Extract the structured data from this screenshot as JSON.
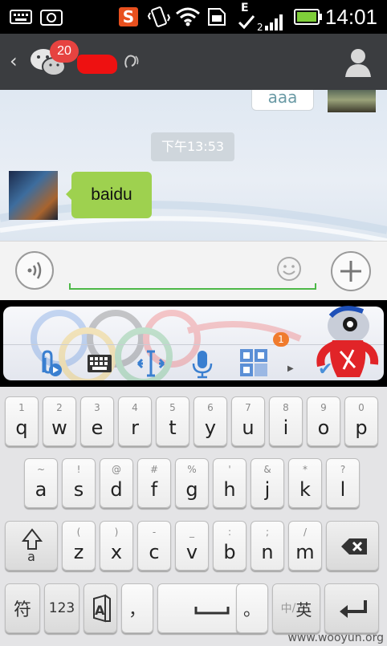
{
  "status_bar": {
    "time": "14:01",
    "icons": [
      "keyboard-icon",
      "screenshot-icon",
      "sogou-s-icon",
      "vibrate-icon",
      "wifi-icon",
      "sim-icon",
      "edge-signal-icon",
      "battery-icon"
    ],
    "sogou_letter": "S",
    "edge_letter": "E"
  },
  "header": {
    "unread_badge": "20",
    "back_glyph": "‹"
  },
  "chat": {
    "sent_message_partial": "aaa",
    "timestamp": "下午13:53",
    "received_message": "baidu"
  },
  "ime_toolbar": {
    "notification_count": "1",
    "tools": [
      "attachment-icon",
      "keyboard-switch-icon",
      "cursor-move-icon",
      "microphone-icon",
      "grid-apps-icon"
    ]
  },
  "keyboard": {
    "row1": [
      {
        "alt": "1",
        "key": "q"
      },
      {
        "alt": "2",
        "key": "w"
      },
      {
        "alt": "3",
        "key": "e"
      },
      {
        "alt": "4",
        "key": "r"
      },
      {
        "alt": "5",
        "key": "t"
      },
      {
        "alt": "6",
        "key": "y"
      },
      {
        "alt": "7",
        "key": "u"
      },
      {
        "alt": "8",
        "key": "i"
      },
      {
        "alt": "9",
        "key": "o"
      },
      {
        "alt": "0",
        "key": "p"
      }
    ],
    "row2": [
      {
        "alt": "~",
        "key": "a"
      },
      {
        "alt": "!",
        "key": "s"
      },
      {
        "alt": "@",
        "key": "d"
      },
      {
        "alt": "#",
        "key": "f"
      },
      {
        "alt": "%",
        "key": "g"
      },
      {
        "alt": "'",
        "key": "h"
      },
      {
        "alt": "&",
        "key": "j"
      },
      {
        "alt": "*",
        "key": "k"
      },
      {
        "alt": "?",
        "key": "l"
      }
    ],
    "row3": [
      {
        "alt": "(",
        "key": "z"
      },
      {
        "alt": ")",
        "key": "x"
      },
      {
        "alt": "-",
        "key": "c"
      },
      {
        "alt": "_",
        "key": "v"
      },
      {
        "alt": ":",
        "key": "b"
      },
      {
        "alt": ";",
        "key": "n"
      },
      {
        "alt": "/",
        "key": "m"
      }
    ],
    "shift_label": "a",
    "symbol_key": "符",
    "number_key": "123",
    "comma_key": "，",
    "period_key": "。",
    "lang_key_cn": "中",
    "lang_key_en": "英"
  },
  "watermark": "www.wooyun.org"
}
